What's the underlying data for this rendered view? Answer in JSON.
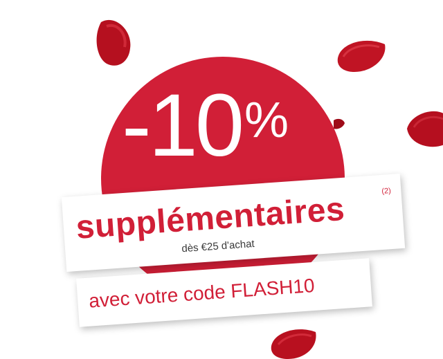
{
  "promo": {
    "discount_value": "-10",
    "discount_symbol": "%",
    "headline": "supplémentaires",
    "footnote": "(2)",
    "condition": "dès €25 d'achat",
    "code_line": "avec votre code FLASH10"
  },
  "colors": {
    "accent": "#d11f37",
    "petal_dark": "#9e0b18",
    "background": "#ffffff"
  }
}
